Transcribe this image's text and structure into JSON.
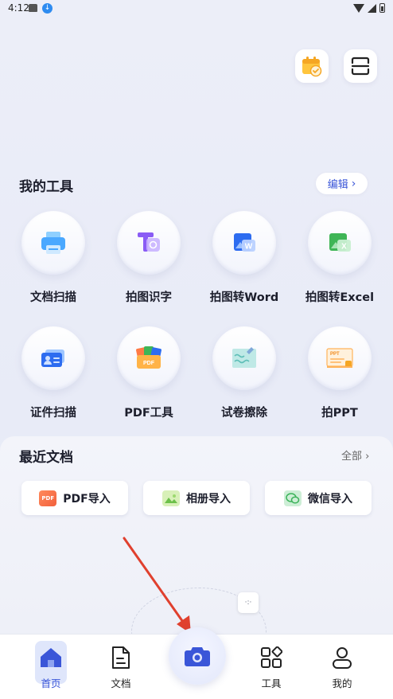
{
  "status_bar": {
    "time": "4:12"
  },
  "my_tools": {
    "title": "我的工具",
    "edit_label": "编辑",
    "items": [
      {
        "label": "文档扫描",
        "icon": "printer-scan-icon"
      },
      {
        "label": "拍图识字",
        "icon": "text-recognition-icon"
      },
      {
        "label": "拍图转Word",
        "icon": "word-icon"
      },
      {
        "label": "拍图转Excel",
        "icon": "excel-icon"
      },
      {
        "label": "证件扫描",
        "icon": "id-card-icon"
      },
      {
        "label": "PDF工具",
        "icon": "pdf-tools-icon"
      },
      {
        "label": "试卷擦除",
        "icon": "paper-erase-icon"
      },
      {
        "label": "拍PPT",
        "icon": "ppt-icon"
      }
    ]
  },
  "recent_docs": {
    "title": "最近文档",
    "all_label": "全部",
    "imports": [
      {
        "label": "PDF导入",
        "icon_text": "PDF"
      },
      {
        "label": "相册导入",
        "icon_text": ""
      },
      {
        "label": "微信导入",
        "icon_text": ""
      }
    ]
  },
  "bottom_nav": {
    "home": "首页",
    "docs": "文档",
    "tools": "工具",
    "mine": "我的"
  },
  "colors": {
    "accent": "#3a56d8",
    "arrow": "#e0402e"
  }
}
